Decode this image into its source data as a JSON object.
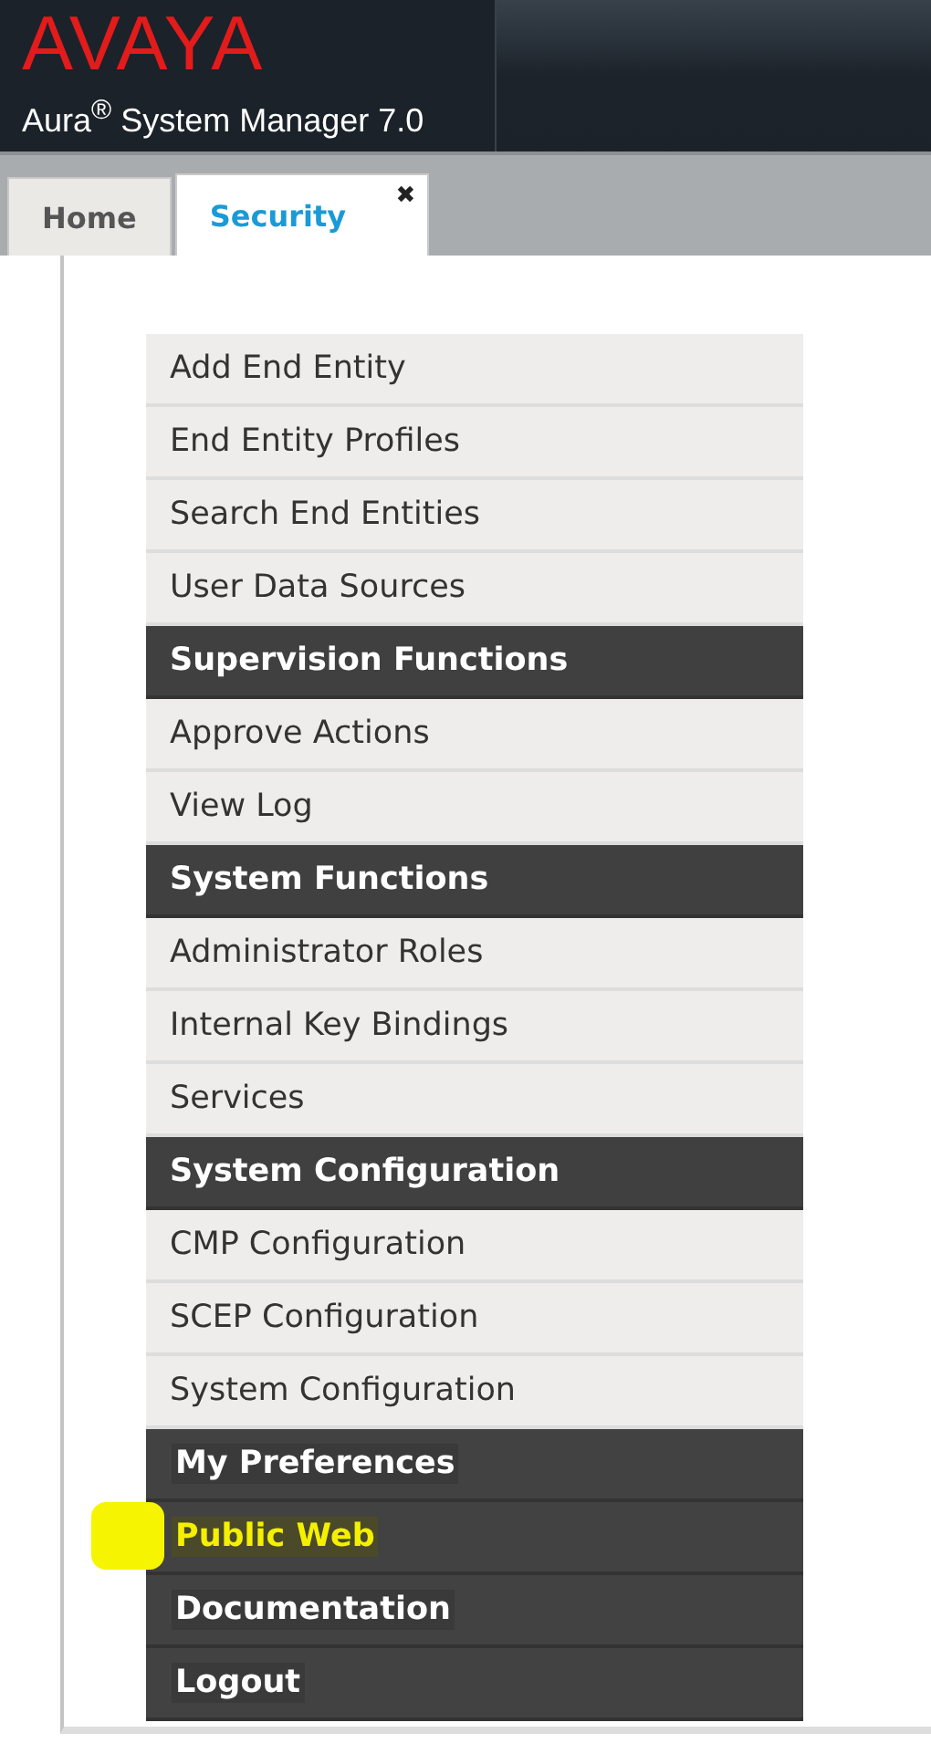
{
  "header": {
    "logo": "AVAYA",
    "product": "Aura$^{®}$ System Manager 7.0"
  },
  "tabs": [
    {
      "label": "Home",
      "selected": false
    },
    {
      "label": "Security",
      "selected": true,
      "close": "✖"
    }
  ],
  "menu": [
    {
      "kind": "link",
      "label": "Add End Entity"
    },
    {
      "kind": "link",
      "label": "End Entity Profiles"
    },
    {
      "kind": "link",
      "label": "Search End Entities"
    },
    {
      "kind": "link",
      "label": "User Data Sources"
    },
    {
      "kind": "header",
      "label": "Supervision Functions"
    },
    {
      "kind": "link",
      "label": "Approve Actions"
    },
    {
      "kind": "link",
      "label": "View Log"
    },
    {
      "kind": "header",
      "label": "System Functions"
    },
    {
      "kind": "link",
      "label": "Administrator Roles"
    },
    {
      "kind": "link",
      "label": "Internal Key Bindings"
    },
    {
      "kind": "link",
      "label": "Services"
    },
    {
      "kind": "header",
      "label": "System Configuration"
    },
    {
      "kind": "link",
      "label": "CMP Configuration"
    },
    {
      "kind": "link",
      "label": "SCEP Configuration"
    },
    {
      "kind": "link",
      "label": "System Configuration"
    },
    {
      "kind": "global",
      "label": "My Preferences",
      "highlighted": false
    },
    {
      "kind": "global",
      "label": "Public Web",
      "highlighted": true
    },
    {
      "kind": "global",
      "label": "Documentation",
      "highlighted": false
    },
    {
      "kind": "global",
      "label": "Logout",
      "highlighted": false
    }
  ]
}
